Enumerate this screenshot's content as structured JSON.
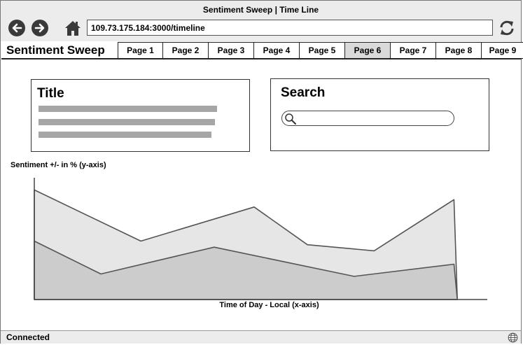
{
  "window": {
    "title": "Sentiment Sweep | Time Line"
  },
  "toolbar": {
    "url": "109.73.175.184:3000/timeline"
  },
  "navbar": {
    "brand": "Sentiment Sweep",
    "tabs": [
      "Page 1",
      "Page 2",
      "Page 3",
      "Page 4",
      "Page 5",
      "Page 6",
      "Page 7",
      "Page 8",
      "Page 9"
    ],
    "active_tab": "Page 6"
  },
  "title_panel": {
    "heading": "Title"
  },
  "search_panel": {
    "heading": "Search",
    "query": ""
  },
  "chart_data": {
    "type": "area",
    "ylabel": "Sentiment +/- in % (y-axis)",
    "xlabel": "Time of Day - Local (x-axis)",
    "series": [
      {
        "values": [
          [
            0,
            90
          ],
          [
            1.6,
            48
          ],
          [
            3.3,
            76
          ],
          [
            4.1,
            45
          ],
          [
            5.1,
            40
          ],
          [
            6.3,
            82
          ],
          [
            6.35,
            0
          ]
        ]
      },
      {
        "values": [
          [
            0,
            48
          ],
          [
            1.0,
            21
          ],
          [
            2.7,
            43
          ],
          [
            4.8,
            19
          ],
          [
            6.3,
            29
          ],
          [
            6.35,
            0
          ]
        ]
      }
    ],
    "xlim": [
      0,
      6.8
    ],
    "ylim": [
      0,
      100
    ],
    "colors": {
      "upper_fill": "#e6e6e6",
      "lower_fill": "#cccccc",
      "stroke": "#555555"
    }
  },
  "statusbar": {
    "status": "Connected"
  }
}
